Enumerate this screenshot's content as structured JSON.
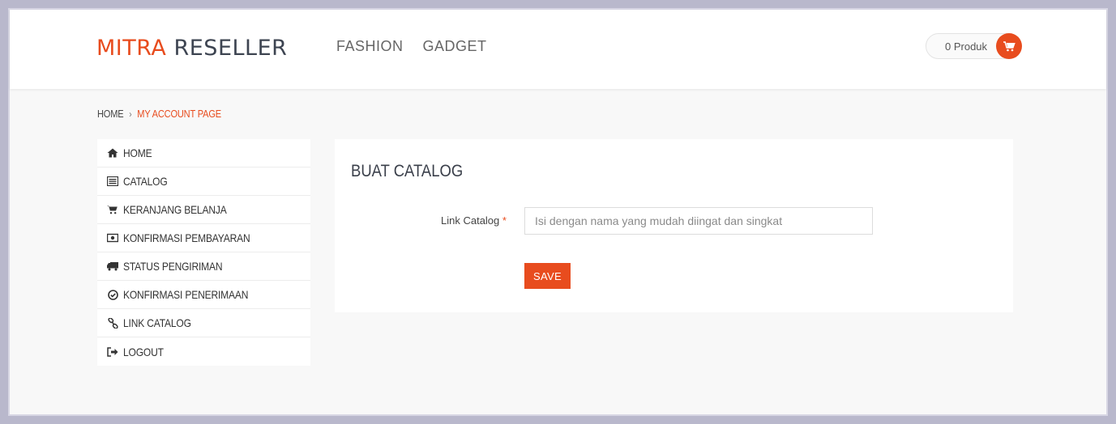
{
  "header": {
    "logo_part1": "MITRA",
    "logo_part2": "RESELLER",
    "nav": [
      {
        "label": "FASHION"
      },
      {
        "label": "GADGET"
      }
    ],
    "cart_label": "0 Produk",
    "cart_icon": "shopping-cart-icon"
  },
  "breadcrumb": {
    "home": "HOME",
    "separator": "›",
    "current": "MY ACCOUNT PAGE"
  },
  "sidebar": {
    "items": [
      {
        "label": "HOME",
        "icon": "home-icon"
      },
      {
        "label": "CATALOG",
        "icon": "list-icon"
      },
      {
        "label": "KERANJANG BELANJA",
        "icon": "shopping-cart-icon"
      },
      {
        "label": "KONFIRMASI PEMBAYARAN",
        "icon": "money-icon"
      },
      {
        "label": "STATUS PENGIRIMAN",
        "icon": "truck-icon"
      },
      {
        "label": "KONFIRMASI PENERIMAAN",
        "icon": "check-circle-icon"
      },
      {
        "label": "LINK CATALOG",
        "icon": "link-icon"
      },
      {
        "label": "LOGOUT",
        "icon": "sign-out-icon"
      }
    ]
  },
  "panel": {
    "title": "BUAT CATALOG",
    "field_label": "Link Catalog",
    "required_marker": "*",
    "input_value": "",
    "input_placeholder": "Isi dengan nama yang mudah diingat dan singkat",
    "save_label": "SAVE"
  },
  "colors": {
    "accent": "#e84c1e",
    "text_dark": "#3d4451",
    "background": "#f8f8f8"
  }
}
